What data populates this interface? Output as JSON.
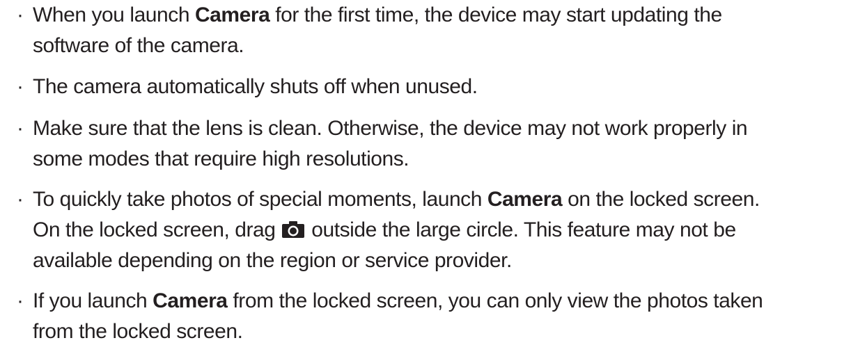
{
  "notes": [
    {
      "lines": [
        [
          "When you launch ",
          {
            "b": "Camera"
          },
          " for the first time, the device may start updating the"
        ],
        [
          "software of the camera."
        ]
      ]
    },
    {
      "lines": [
        [
          "The camera automatically shuts off when unused."
        ]
      ]
    },
    {
      "lines": [
        [
          "Make sure that the lens is clean. Otherwise, the device may not work properly in"
        ],
        [
          "some modes that require high resolutions."
        ]
      ]
    },
    {
      "lines": [
        [
          "To quickly take photos of special moments, launch ",
          {
            "b": "Camera"
          },
          " on the locked screen."
        ],
        [
          "On the locked screen, drag ",
          {
            "icon": "camera-icon"
          },
          " outside the large circle. This feature may not be"
        ],
        [
          "available depending on the region or service provider."
        ]
      ]
    },
    {
      "lines": [
        [
          "If you launch ",
          {
            "b": "Camera"
          },
          " from the locked screen, you can only view the photos taken"
        ],
        [
          "from the locked screen."
        ]
      ]
    }
  ],
  "bullet_char": "·",
  "colors": {
    "text": "#231f20",
    "icon": "#231f20"
  }
}
